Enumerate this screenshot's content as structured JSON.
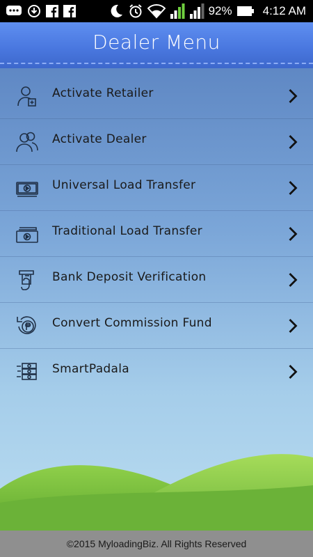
{
  "status_bar": {
    "battery": "92%",
    "time": "4:12 AM",
    "icons": [
      "chat-bubble-icon",
      "download-icon",
      "facebook-icon",
      "facebook-icon",
      "moon-icon",
      "alarm-icon",
      "wifi-icon",
      "signal-icon",
      "signal-icon",
      "battery-icon"
    ]
  },
  "header": {
    "title": "Dealer Menu"
  },
  "menu": {
    "items": [
      {
        "label": "Activate Retailer",
        "icon": "add-user-icon"
      },
      {
        "label": "Activate Dealer",
        "icon": "users-icon"
      },
      {
        "label": "Universal Load Transfer",
        "icon": "money-transfer-icon"
      },
      {
        "label": "Traditional Load Transfer",
        "icon": "money-stack-icon"
      },
      {
        "label": "Bank Deposit Verification",
        "icon": "atm-deposit-icon"
      },
      {
        "label": "Convert Commission Fund",
        "icon": "peso-convert-icon"
      },
      {
        "label": "SmartPadala",
        "icon": "money-send-icon"
      }
    ]
  },
  "footer": {
    "copyright": "©2015 MyloadingBiz. All Rights Reserved"
  }
}
